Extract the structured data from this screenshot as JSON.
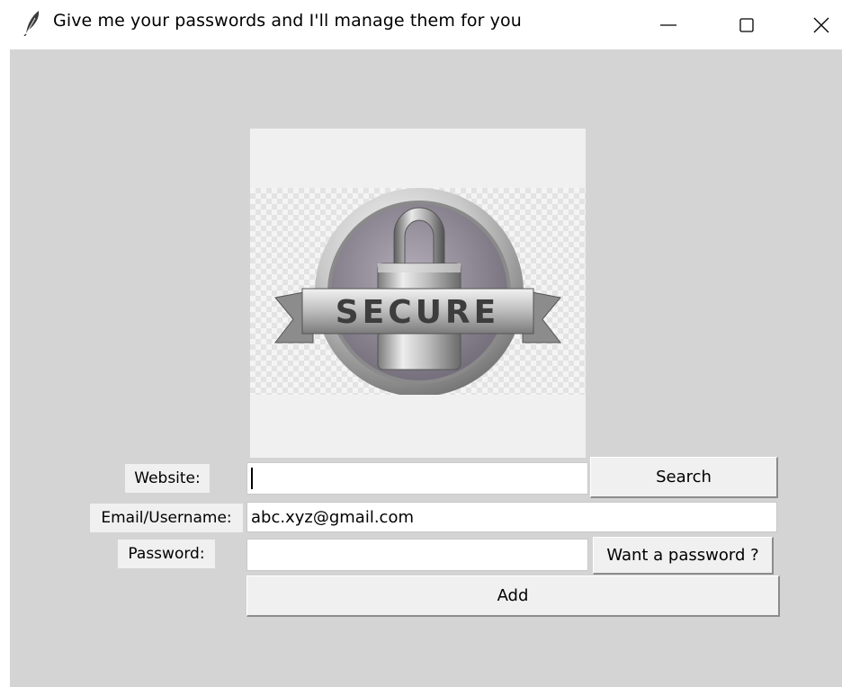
{
  "window": {
    "title": "Give me your passwords and I'll manage them for you",
    "icon": "feather-icon"
  },
  "logo": {
    "text": "SECURE",
    "icon": "padlock-badge-logo"
  },
  "form": {
    "website_label": "Website:",
    "website_value": "",
    "email_label": "Email/Username:",
    "email_value": "abc.xyz@gmail.com",
    "password_label": "Password:",
    "password_value": "",
    "search_button": "Search",
    "generate_button": "Want a password ?",
    "add_button": "Add"
  }
}
